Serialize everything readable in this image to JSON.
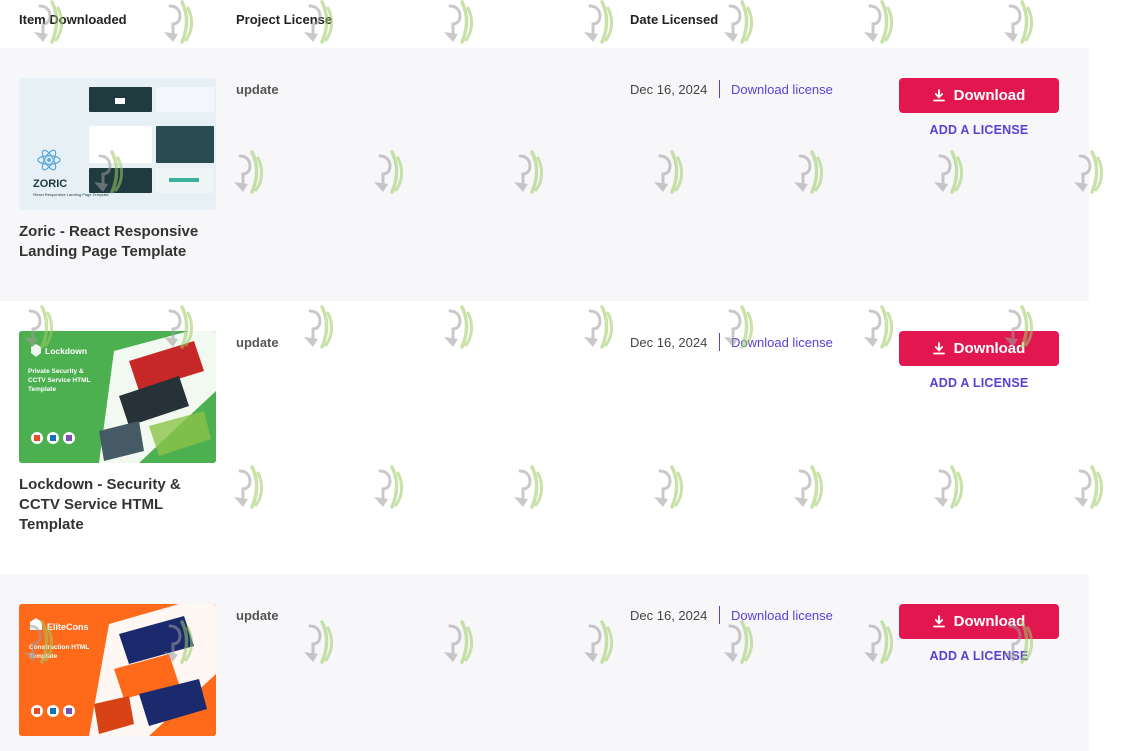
{
  "table": {
    "headers": {
      "item": "Item Downloaded",
      "license": "Project License",
      "date": "Date Licensed"
    }
  },
  "rows": [
    {
      "title": "Zoric - React Responsive Landing Page Template",
      "license": "update",
      "date": "Dec 16, 2024",
      "license_link": "Download license",
      "download_label": "Download",
      "add_license_label": "ADD A LICENSE",
      "thumb": {
        "brand": "ZORIC",
        "tagline": "React Responsive Landing Page Template"
      }
    },
    {
      "title": "Lockdown - Security & CCTV Service HTML Template",
      "license": "update",
      "date": "Dec 16, 2024",
      "license_link": "Download license",
      "download_label": "Download",
      "add_license_label": "ADD A LICENSE",
      "thumb": {
        "brand": "Lockdown",
        "tagline": "Private Security & CCTV Service HTML Template"
      }
    },
    {
      "title": "EliteCons",
      "license": "update",
      "date": "Dec 16, 2024",
      "license_link": "Download license",
      "download_label": "Download",
      "add_license_label": "ADD A LICENSE",
      "thumb": {
        "brand": "EliteCons",
        "tagline": "Construction HTML Template"
      }
    }
  ],
  "colors": {
    "accent_red": "#e2174f",
    "link_purple": "#5b3fd6",
    "row_shade": "#f7f7fa"
  },
  "icons": {
    "download": "download-icon",
    "react": "react-logo-icon"
  }
}
